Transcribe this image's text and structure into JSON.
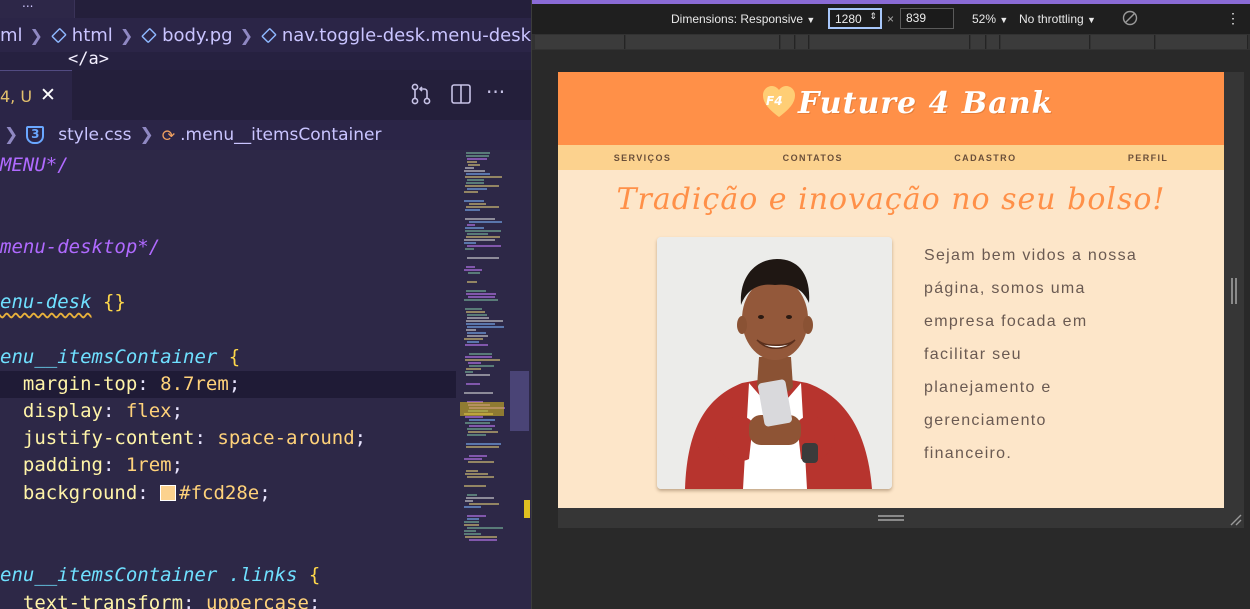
{
  "vscode": {
    "top_tab": "...",
    "breadcrumb_1": [
      "ml",
      "html",
      "body.pg",
      "nav.toggle-desk.menu-desk"
    ],
    "code_anchor": "</a>",
    "active_tab_label": "4, U",
    "active_tab_close": "✕",
    "toolbar_icons": [
      "source-control-icon",
      "split-editor-icon",
      "more-icon"
    ],
    "breadcrumb_2": {
      "file": "style.css",
      "css_badge": "3",
      "symbol": ".menu__itemsContainer"
    },
    "code": {
      "l1": "MENU*/",
      "l2": "menu-desktop*/",
      "l3_sel": "enu-desk",
      "l3_brace": " {}",
      "l4_sel": "enu__itemsContainer",
      "l4_brace": " {",
      "p1": "margin-top",
      "v1": "8.7rem",
      "p2": "display",
      "v2": "flex",
      "p3": "justify-content",
      "v3": "space-around",
      "p4": "padding",
      "v4": "1rem",
      "p5": "background",
      "v5": "#fcd28e",
      "l5_sel": "enu__itemsContainer .links",
      "l5_brace": " {",
      "p6": "text-transform",
      "v6": "uppercase"
    }
  },
  "devtools": {
    "dimensions_label": "Dimensions: Responsive",
    "width": "1280",
    "times": "×",
    "height": "839",
    "zoom": "52%",
    "throttling": "No throttling",
    "rotate_icon": "rotate-icon",
    "more_icon": "⋮",
    "dropdown_glyph": "▼"
  },
  "site": {
    "logo_initials": "F4",
    "title": "Future 4 Bank",
    "nav": [
      "Serviços",
      "Contatos",
      "Cadastro",
      "Perfil"
    ],
    "hero_title": "Tradição e inovação no seu bolso!",
    "intro": "Sejam bem vidos a nossa página, somos uma empresa focada em facilitar seu planejamento e gerenciamento financeiro.",
    "colors": {
      "header": "#ff9048",
      "nav": "#fcd28e",
      "body": "#fde6c9"
    }
  }
}
